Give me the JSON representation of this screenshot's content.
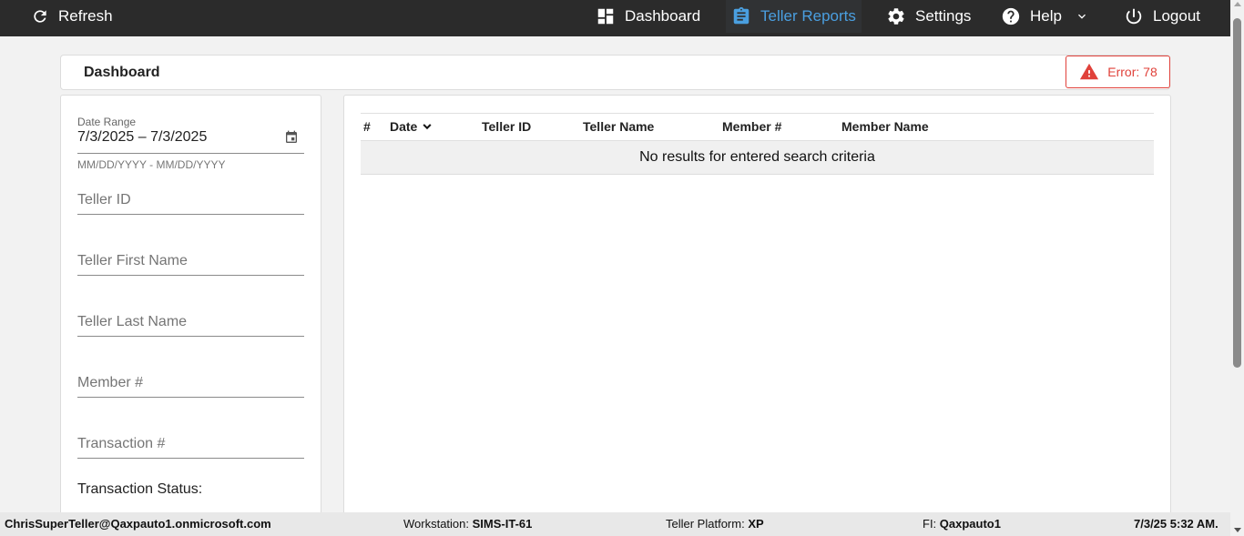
{
  "topbar": {
    "refresh_label": "Refresh",
    "nav": [
      {
        "label": "Dashboard",
        "icon": "dashboard-icon"
      },
      {
        "label": "Teller Reports",
        "icon": "clipboard-icon",
        "active": true
      },
      {
        "label": "Settings",
        "icon": "gear-icon"
      },
      {
        "label": "Help",
        "icon": "help-icon"
      },
      {
        "label": "Logout",
        "icon": "power-icon"
      }
    ],
    "active_color": "#4a9fe0"
  },
  "page": {
    "title": "Dashboard",
    "error_label": "Error: 78",
    "error_color": "#e0413a"
  },
  "filters": {
    "date_range_label": "Date Range",
    "date_range_value": "7/3/2025 – 7/3/2025",
    "date_range_hint": "MM/DD/YYYY - MM/DD/YYYY",
    "teller_id_placeholder": "Teller ID",
    "teller_first_placeholder": "Teller First Name",
    "teller_last_placeholder": "Teller Last Name",
    "member_placeholder": "Member #",
    "transaction_placeholder": "Transaction #",
    "status_label": "Transaction Status:"
  },
  "results": {
    "columns": [
      "#",
      "Date",
      "Teller ID",
      "Teller Name",
      "Member #",
      "Member Name"
    ],
    "empty_message": "No results for entered search criteria"
  },
  "footer": {
    "user": "ChrisSuperTeller@Qaxpauto1.onmicrosoft.com",
    "workstation_label": "Workstation:",
    "workstation_value": "SIMS-IT-61",
    "platform_label": "Teller Platform:",
    "platform_value": "XP",
    "fi_label": "FI:",
    "fi_value": "Qaxpauto1",
    "datetime": "7/3/25 5:32 AM."
  }
}
